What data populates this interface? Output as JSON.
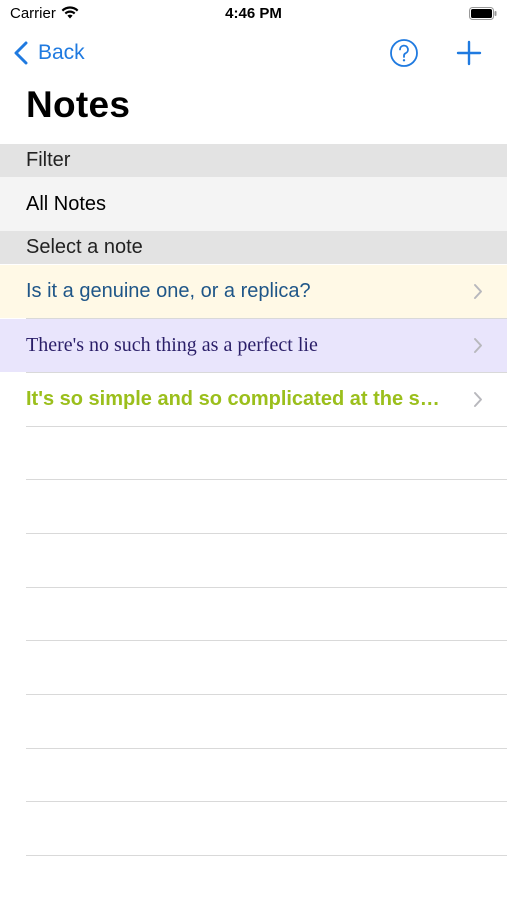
{
  "status": {
    "carrier": "Carrier",
    "time": "4:46 PM"
  },
  "nav": {
    "back_label": "Back"
  },
  "title": "Notes",
  "filter": {
    "header": "Filter",
    "value": "All Notes"
  },
  "notes_section": {
    "header": "Select a note",
    "items": [
      {
        "text": "Is it a genuine one, or a replica?"
      },
      {
        "text": "There's no such thing as a perfect lie"
      },
      {
        "text": "It's so simple and so complicated at the s…"
      }
    ]
  },
  "colors": {
    "accent": "#1f7ae0",
    "note1_bg": "#fff9e6",
    "note1_text": "#1f5688",
    "note2_bg": "#e9e5fc",
    "note2_text": "#2a1e68",
    "note3_text": "#9bbf1c",
    "section_bg": "#e3e3e3"
  }
}
